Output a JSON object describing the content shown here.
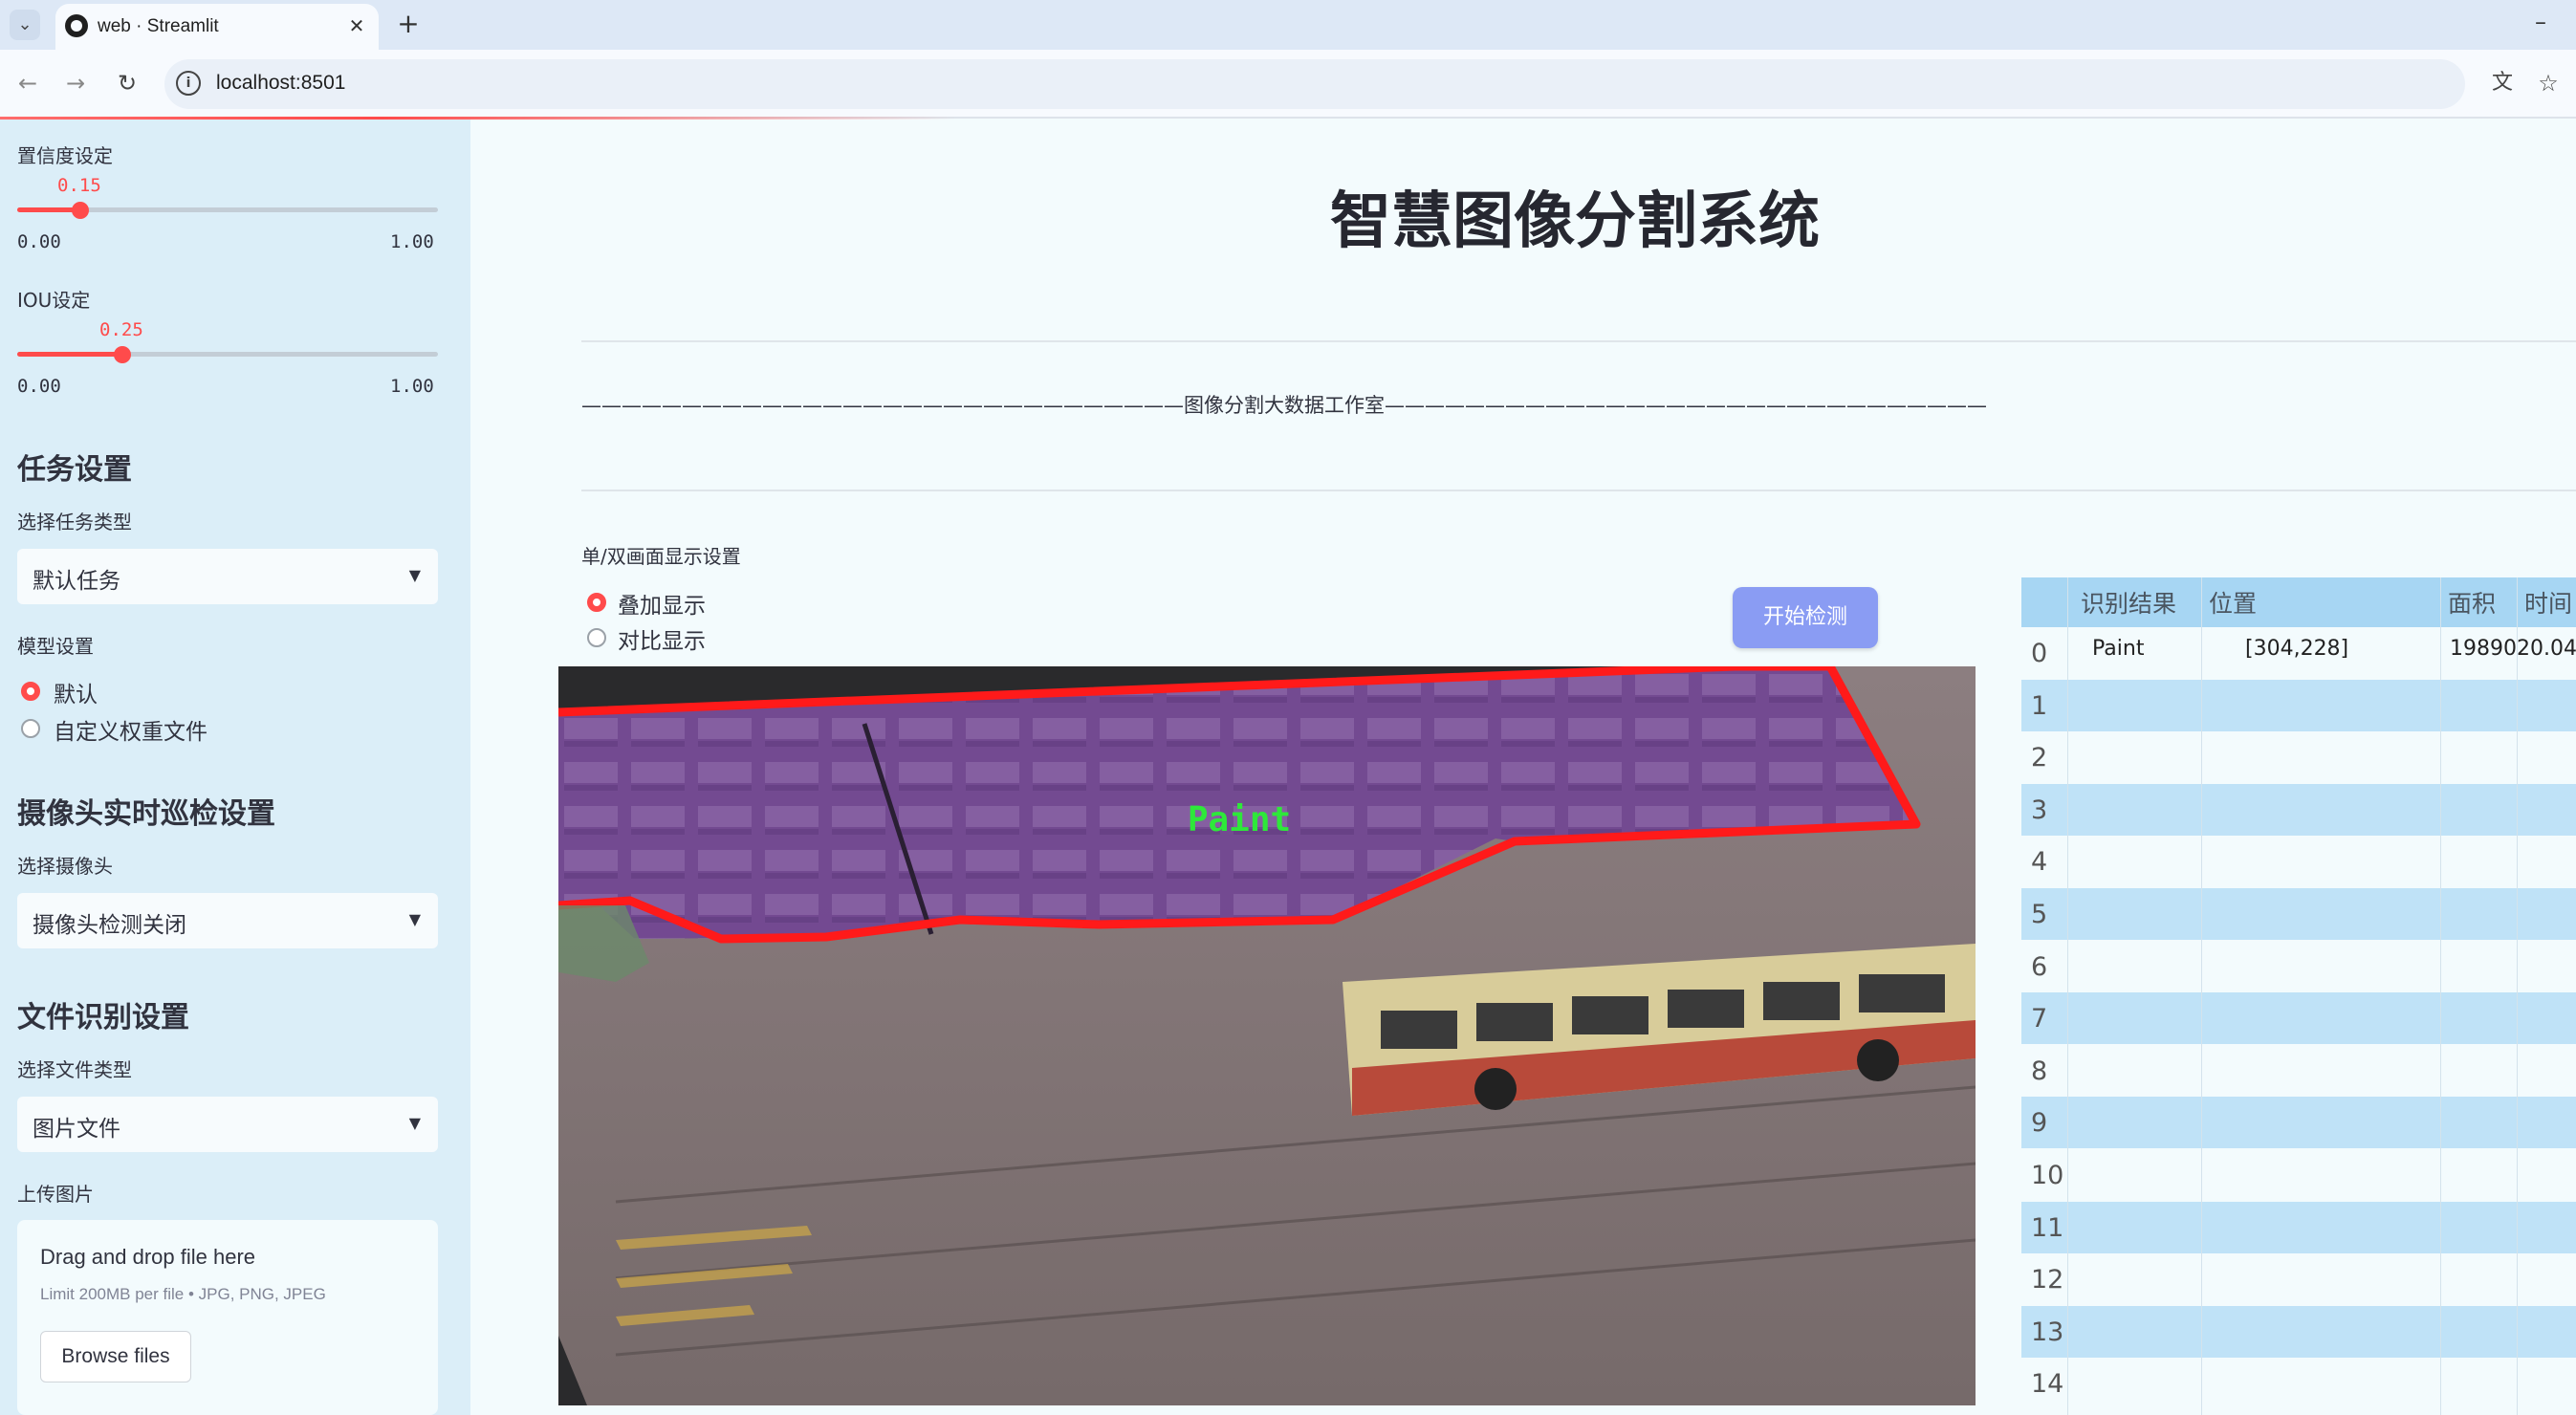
{
  "browser": {
    "tab_title": "web · Streamlit",
    "url": "localhost:8501"
  },
  "sidebar": {
    "confidence": {
      "label": "置信度设定",
      "value": "0.15",
      "value_num": 0.15,
      "min": "0.00",
      "max": "1.00"
    },
    "iou": {
      "label": "IOU设定",
      "value": "0.25",
      "value_num": 0.25,
      "min": "0.00",
      "max": "1.00"
    },
    "task_section": {
      "title": "任务设置",
      "select_label": "选择任务类型",
      "select_value": "默认任务"
    },
    "model": {
      "label": "模型设置",
      "options": [
        "默认",
        "自定义权重文件"
      ],
      "selected": 0
    },
    "camera_section": {
      "title": "摄像头实时巡检设置",
      "select_label": "选择摄像头",
      "select_value": "摄像头检测关闭"
    },
    "file_section": {
      "title": "文件识别设置",
      "select_label": "选择文件类型",
      "select_value": "图片文件"
    },
    "upload": {
      "label": "上传图片",
      "drop_text": "Drag and drop file here",
      "limit_text": "Limit 200MB per file • JPG, PNG, JPEG",
      "browse_label": "Browse files"
    }
  },
  "main": {
    "title": "智慧图像分割系统",
    "subtitle": "——————————————————————————————图像分割大数据工作室——————————————————————————————",
    "display": {
      "label": "单/双画面显示设置",
      "options": [
        "叠加显示",
        "对比显示"
      ],
      "selected": 0
    },
    "start_button": "开始检测",
    "detection_label": "Paint"
  },
  "results_table": {
    "columns": [
      "识别结果",
      "位置",
      "面积",
      "时间"
    ],
    "rows": [
      {
        "index": "0",
        "result": "Paint",
        "position": "[304,228]",
        "area": "1989020.04",
        "time": ""
      },
      {
        "index": "1"
      },
      {
        "index": "2"
      },
      {
        "index": "3"
      },
      {
        "index": "4"
      },
      {
        "index": "5"
      },
      {
        "index": "6"
      },
      {
        "index": "7"
      },
      {
        "index": "8"
      },
      {
        "index": "9"
      },
      {
        "index": "10"
      },
      {
        "index": "11"
      },
      {
        "index": "12"
      },
      {
        "index": "13"
      },
      {
        "index": "14"
      }
    ]
  },
  "colors": {
    "accent": "#ff4b4b",
    "button": "#8a9cf3",
    "sidebar_bg": "#dbeef8",
    "table_header": "#a7d6f3",
    "mask_outline": "#ff1a1a",
    "label_text": "#2ee83a"
  }
}
